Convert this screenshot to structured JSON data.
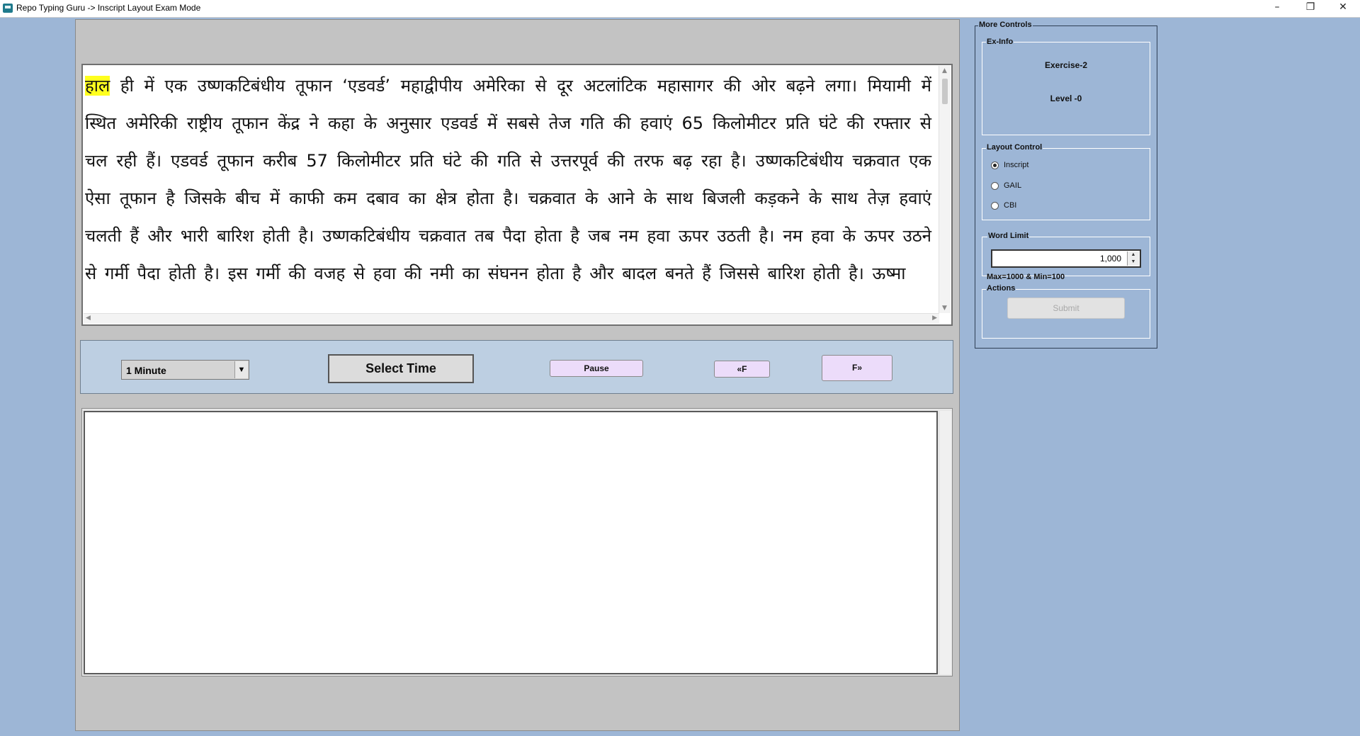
{
  "window": {
    "title": "Repo Typing Guru -> Inscript Layout Exam Mode",
    "minimize": "–",
    "restore": "❐",
    "close": "✕"
  },
  "passage": {
    "highlighted_word": "हाल",
    "text": " ही में एक उष्णकटिबंधीय तूफान ‘एडवर्ड’ महाद्वीपीय अमेरिका से दूर अटलांटिक महासागर की ओर बढ़ने लगा। मियामी में स्थित अमेरिकी राष्ट्रीय तूफान केंद्र ने कहा के अनुसार एडवर्ड में सबसे तेज गति की हवाएं 65 किलोमीटर प्रति घंटे की रफ्तार से चल रही हैं। एडवर्ड तूफान करीब 57 किलोमीटर प्रति घंटे की गति से उत्तरपूर्व की तरफ बढ़ रहा है। उष्णकटिबंधीय चक्रवात एक ऐसा तूफान है जिसके बीच में काफी कम दबाव का क्षेत्र होता है। चक्रवात के आने के साथ बिजली कड़कने के साथ तेज़ हवाएं चलती हैं और भारी बारिश होती है। उष्णकटिबंधीय चक्रवात तब पैदा होता है जब नम हवा ऊपर उठती है। नम हवा के ऊपर उठने से गर्मी पैदा होती है। इस गर्मी की वजह से हवा की नमी का संघनन होता है और बादल बनते हैं जिससे बारिश होती है। ऊष्मा",
    "highlight_color": "#ffff1e"
  },
  "controls": {
    "time_select": "1 Minute",
    "select_time_label": "Select Time",
    "pause_label": "Pause",
    "font_decrease_label": "«F",
    "font_increase_label": "F»"
  },
  "typing": {
    "value": ""
  },
  "more_controls": {
    "title": "More Controls",
    "ex_info": {
      "title": "Ex-Info",
      "exercise": "Exercise-2",
      "level": "Level -0"
    },
    "layout_control": {
      "title": "Layout Control",
      "options": [
        "Inscript",
        "GAIL",
        "CBI"
      ],
      "selected": "Inscript"
    },
    "word_limit": {
      "title": "Word Limit",
      "value": "1,000",
      "note": "Max=1000 & Min=100"
    },
    "actions": {
      "title": "Actions",
      "submit_label": "Submit"
    }
  },
  "colors": {
    "background": "#9db6d6",
    "panel": "#c3c3c3",
    "button_lavender": "#ecdcfa"
  }
}
